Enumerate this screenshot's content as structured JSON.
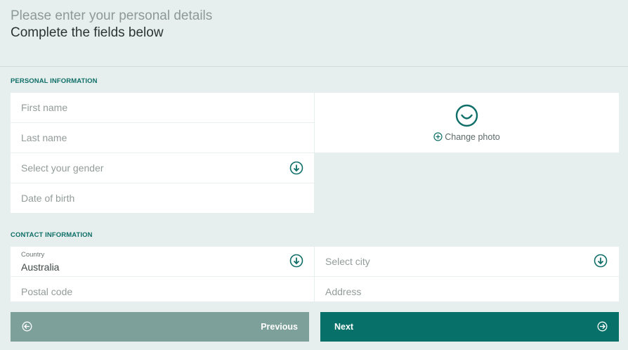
{
  "header": {
    "title": "Please enter your personal details",
    "subtitle": "Complete the fields below"
  },
  "personal": {
    "section_label": "PERSONAL INFORMATION",
    "first_name_placeholder": "First name",
    "last_name_placeholder": "Last name",
    "gender_placeholder": "Select your gender",
    "dob_placeholder": "Date of birth",
    "change_photo_label": "Change photo"
  },
  "contact": {
    "section_label": "CONTACT INFORMATION",
    "country_label": "Country",
    "country_value": "Australia",
    "city_placeholder": "Select city",
    "postal_placeholder": "Postal code",
    "address_placeholder": "Address"
  },
  "nav": {
    "previous_label": "Previous",
    "next_label": "Next"
  },
  "icons": {
    "gender_dropdown": "arrow-down-circle-icon",
    "country_dropdown": "arrow-down-circle-icon",
    "city_dropdown": "arrow-down-circle-icon",
    "avatar": "smiley-icon",
    "change_photo": "plus-circle-icon",
    "previous": "arrow-left-circle-icon",
    "next": "arrow-right-circle-icon"
  },
  "colors": {
    "accent": "#077169",
    "background": "#e6efed",
    "previous_button": "#7da09a",
    "next_button": "#077169"
  }
}
